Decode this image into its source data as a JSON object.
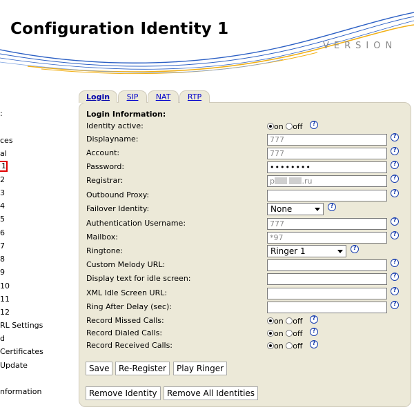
{
  "header": {
    "title": "Configuration Identity 1",
    "version_label": "VERSION"
  },
  "sidebar": {
    "items": [
      {
        "label": ":"
      },
      {
        "label": "ces"
      },
      {
        "label": "al"
      },
      {
        "label": "1"
      },
      {
        "label": "2"
      },
      {
        "label": "3"
      },
      {
        "label": "4"
      },
      {
        "label": "5"
      },
      {
        "label": "6"
      },
      {
        "label": "7"
      },
      {
        "label": "8"
      },
      {
        "label": "9"
      },
      {
        "label": "10"
      },
      {
        "label": "11"
      },
      {
        "label": "12"
      },
      {
        "label": "RL Settings"
      },
      {
        "label": "d"
      },
      {
        "label": "Certificates"
      },
      {
        "label": "Update"
      },
      {
        "label": "nformation"
      }
    ]
  },
  "tabs": [
    {
      "label": "Login"
    },
    {
      "label": "SIP"
    },
    {
      "label": "NAT"
    },
    {
      "label": "RTP"
    }
  ],
  "form": {
    "section_title": "Login Information:",
    "identity_active": {
      "label": "Identity active:",
      "on": "on",
      "off": "off",
      "value": "on"
    },
    "displayname": {
      "label": "Displayname:",
      "value": "777"
    },
    "account": {
      "label": "Account:",
      "value": "777"
    },
    "password": {
      "label": "Password:",
      "value": "••••••••"
    },
    "registrar": {
      "label": "Registrar:",
      "value_start": "p",
      "value_end": ".ru"
    },
    "outbound_proxy": {
      "label": "Outbound Proxy:",
      "value": ""
    },
    "failover_identity": {
      "label": "Failover Identity:",
      "value": "None"
    },
    "auth_username": {
      "label": "Authentication Username:",
      "value": "777"
    },
    "mailbox": {
      "label": "Mailbox:",
      "value": "*97"
    },
    "ringtone": {
      "label": "Ringtone:",
      "value": "Ringer 1"
    },
    "custom_melody_url": {
      "label": "Custom Melody URL:",
      "value": ""
    },
    "display_text_idle": {
      "label": "Display text for idle screen:",
      "value": ""
    },
    "xml_idle_screen_url": {
      "label": "XML Idle Screen URL:",
      "value": ""
    },
    "ring_after_delay": {
      "label": "Ring After Delay (sec):",
      "value": ""
    },
    "record_missed": {
      "label": "Record Missed Calls:",
      "on": "on",
      "off": "off",
      "value": "on"
    },
    "record_dialed": {
      "label": "Record Dialed Calls:",
      "on": "on",
      "off": "off",
      "value": "on"
    },
    "record_received": {
      "label": "Record Received Calls:",
      "on": "on",
      "off": "off",
      "value": "on"
    },
    "help_glyph": "?"
  },
  "buttons": {
    "save": "Save",
    "re_register": "Re-Register",
    "play_ringer": "Play Ringer",
    "remove_identity": "Remove Identity",
    "remove_all_identities": "Remove All Identities"
  },
  "colors": {
    "panel_bg": "#ece9d8",
    "tab_link": "#0000cc",
    "help_icon": "#1a3faf",
    "selected_outline": "#e00000",
    "swoosh": "#2b5fc4"
  }
}
